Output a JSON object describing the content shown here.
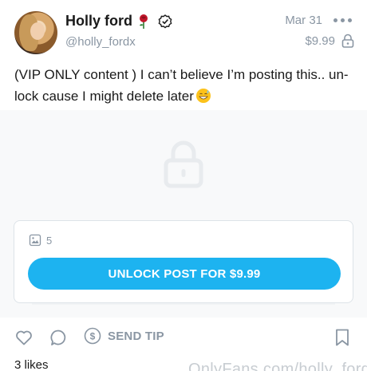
{
  "header": {
    "display_name": "Holly ford",
    "username": "@holly_fordx",
    "date": "Mar 31",
    "price": "$9.99"
  },
  "post": {
    "text": "(VIP ONLY content ) I can’t believe I’m posting this.. un-lock cause I might delete later"
  },
  "unlock_card": {
    "media_count": "5",
    "button_label": "UNLOCK POST FOR $9.99"
  },
  "actions": {
    "tip_label": "SEND TIP"
  },
  "likes": "3 likes",
  "watermark": "OnlyFans.com/holly_fordx",
  "colors": {
    "accent": "#1db3f0",
    "muted": "#8a96a3",
    "text": "#1a1a1a",
    "rose": "#c0172b"
  },
  "icons": {
    "rose": "rose-emoji",
    "verified": "verified-badge",
    "more": "more-horizontal",
    "price_lock": "lock-outline",
    "emoji": "grinning-sweat-emoji",
    "background_lock": "lock",
    "media": "image",
    "like": "heart-outline",
    "comment": "comment-outline",
    "tip": "dollar-circle",
    "bookmark": "bookmark-outline"
  }
}
